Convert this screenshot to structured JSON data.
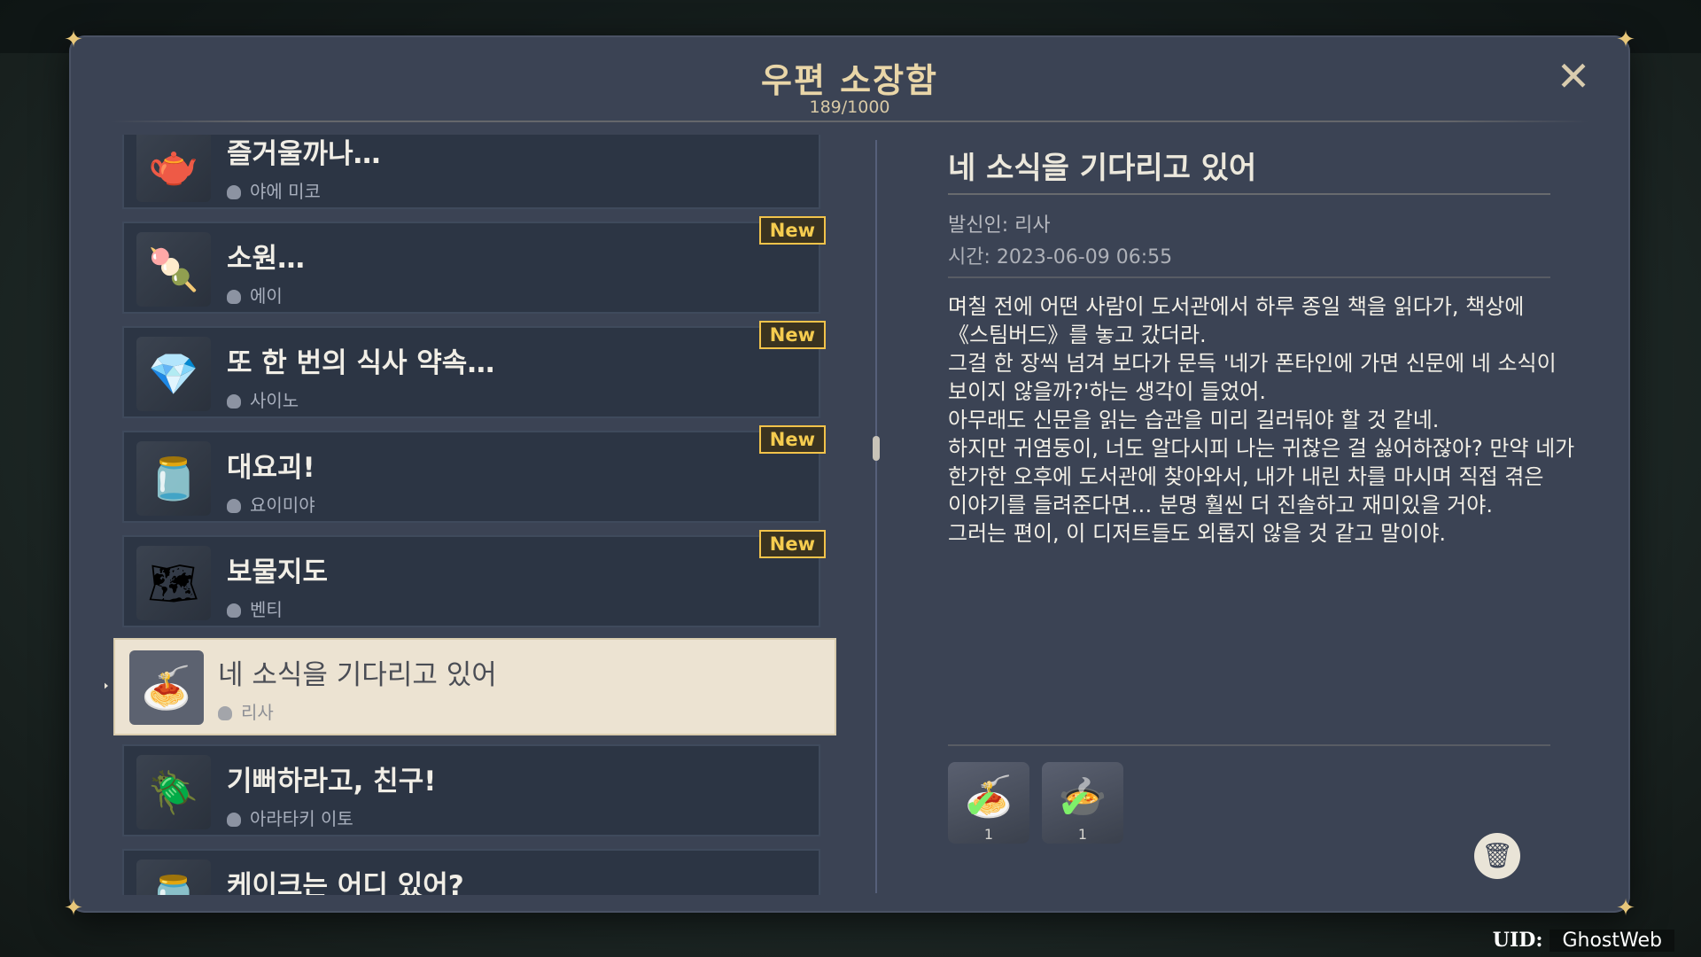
{
  "window": {
    "title": "우편 소장함",
    "count": "189/1000",
    "close_icon": "close-icon"
  },
  "mail_list": [
    {
      "title": "즐거울까나…",
      "sender": "야에 미코",
      "icon": "steel-teapot-icon",
      "new": "",
      "selected": false
    },
    {
      "title": "소원…",
      "sender": "에이",
      "icon": "dango-plate-icon",
      "new": "New",
      "selected": false
    },
    {
      "title": "또 한 번의 식사 약속…",
      "sender": "사이노",
      "icon": "crystal-icon",
      "new": "New",
      "selected": false
    },
    {
      "title": "대요괴!",
      "sender": "요이미야",
      "icon": "jar-icon",
      "new": "New",
      "selected": false
    },
    {
      "title": "보물지도",
      "sender": "벤티",
      "icon": "treasure-map-icon",
      "new": "New",
      "selected": false
    },
    {
      "title": "네 소식을 기다리고 있어",
      "sender": "리사",
      "icon": "noodle-dish-icon",
      "new": "",
      "selected": true
    },
    {
      "title": "기뻐하라고, 친구!",
      "sender": "아라타키 이토",
      "icon": "beetle-icon",
      "new": "",
      "selected": false
    },
    {
      "title": "케이크는 어디 있어?",
      "sender": "",
      "icon": "jar-icon",
      "new": "",
      "selected": false
    }
  ],
  "detail": {
    "title": "네 소식을 기다리고 있어",
    "from": "발신인: 리사",
    "time": "시간: 2023-06-09 06:55",
    "body": "며칠 전에 어떤 사람이 도서관에서 하루 종일 책을 읽다가, 책상에\n《스팀버드》를 놓고 갔더라.\n그걸 한 장씩 넘겨 보다가 문득 '네가 폰타인에 가면 신문에 네 소식이\n보이지 않을까?'하는 생각이 들었어.\n아무래도 신문을 읽는 습관을 미리 길러둬야 할 것 같네.\n하지만 귀염둥이, 너도 알다시피 나는 귀찮은 걸 싫어하잖아? 만약 네가\n한가한 오후에 도서관에 찾아와서, 내가 내린 차를 마시며 직접 겪은\n이야기를 들려준다면… 분명 훨씬 더 진솔하고 재미있을 거야.\n그러는 편이, 이 디저트들도 외롭지 않을 것 같고 말이야.",
    "attachments": [
      {
        "icon": "noodle-dish-icon",
        "qty": "1",
        "claimed": true
      },
      {
        "icon": "soup-bowl-icon",
        "qty": "1",
        "claimed": true
      }
    ],
    "delete_icon": "trash-icon"
  },
  "footer": {
    "uid_label": "UID:",
    "uid_value": "GhostWeb"
  },
  "colors": {
    "panel": "#3b4354",
    "item": "#2c3544",
    "selected_item": "#ece3d2",
    "title_gold": "#e9d6a8",
    "new_badge": "#f5cc4f"
  }
}
